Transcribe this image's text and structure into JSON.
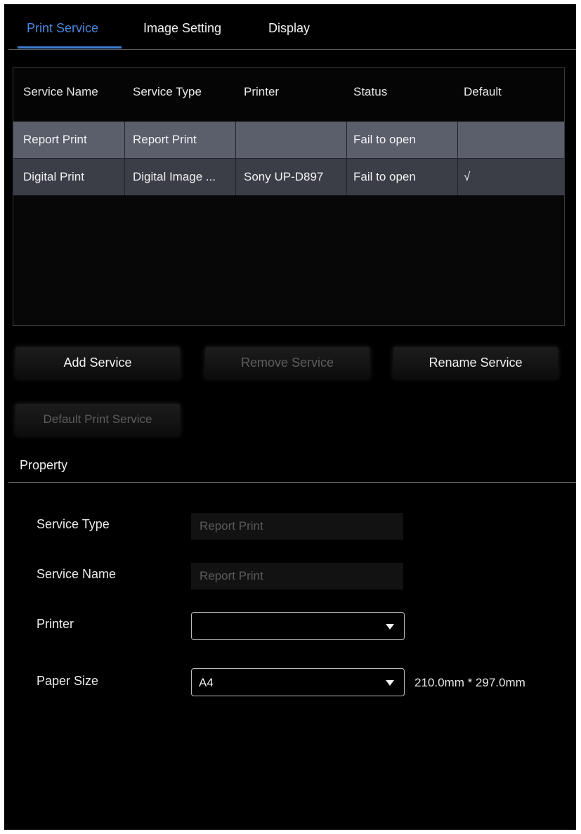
{
  "tabs": [
    {
      "label": "Print Service",
      "active": true
    },
    {
      "label": "Image Setting",
      "active": false
    },
    {
      "label": "Display",
      "active": false
    }
  ],
  "table": {
    "headers": [
      "Service Name",
      "Service Type",
      "Printer",
      "Status",
      "Default"
    ],
    "rows": [
      {
        "name": "Report Print",
        "type": "Report Print",
        "printer": "",
        "status": "Fail to open",
        "default": "",
        "selected": true
      },
      {
        "name": "Digital Print",
        "type": "Digital Image ...",
        "printer": "Sony UP-D897",
        "status": "Fail to open",
        "default": "√",
        "selected": false
      }
    ]
  },
  "buttons": {
    "add": "Add Service",
    "remove": "Remove Service",
    "rename": "Rename Service",
    "default_print": "Default Print Service"
  },
  "property": {
    "title": "Property",
    "service_type_label": "Service Type",
    "service_type_value": "Report Print",
    "service_name_label": "Service Name",
    "service_name_value": "Report Print",
    "printer_label": "Printer",
    "printer_value": "",
    "paper_size_label": "Paper Size",
    "paper_size_value": "A4",
    "paper_dims": "210.0mm * 297.0mm"
  },
  "colors": {
    "accent": "#3f7fd6",
    "background": "#000000",
    "selected_row": "#5b5e6b",
    "row": "#3b3d47"
  },
  "icons": {
    "dropdown": "chevron-down-icon",
    "default_mark": "check-icon"
  }
}
